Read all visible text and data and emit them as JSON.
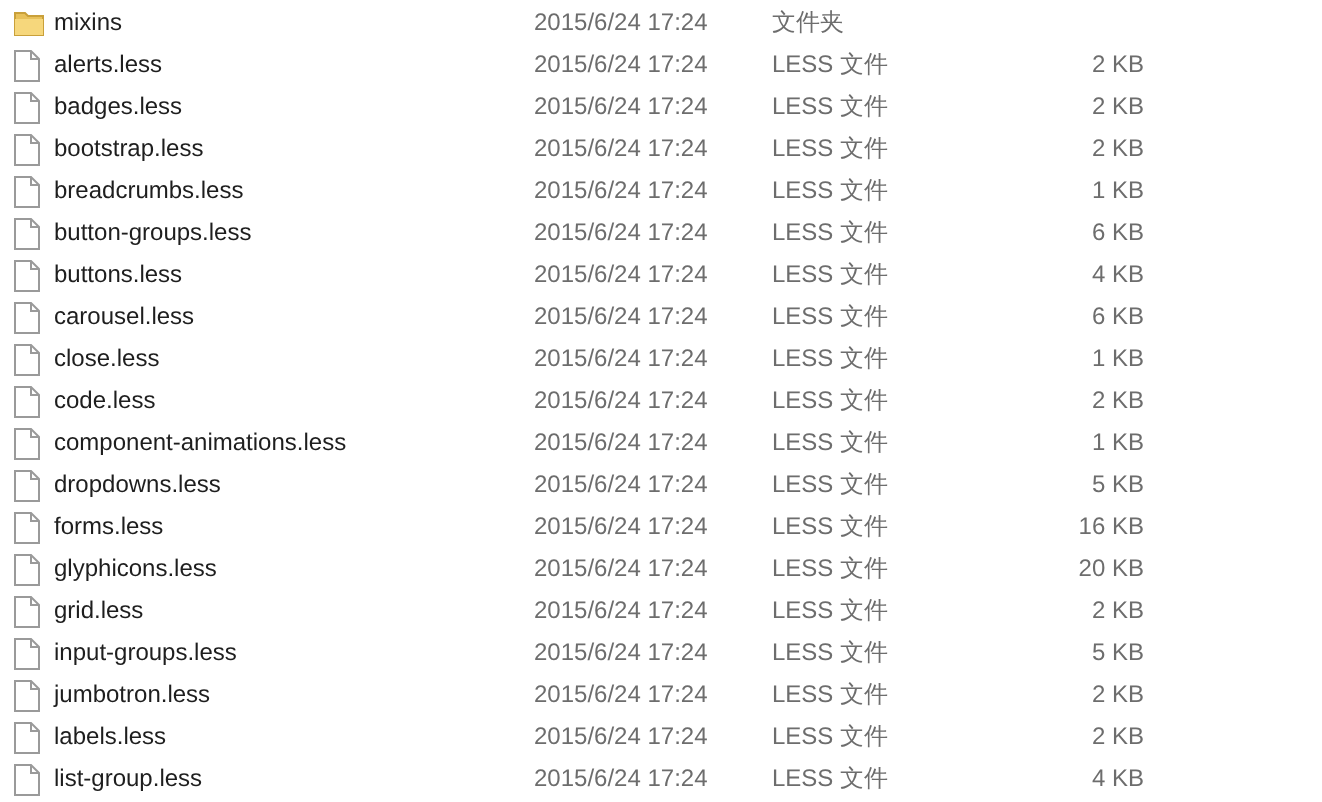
{
  "files": [
    {
      "kind": "folder",
      "name": "mixins",
      "date": "2015/6/24 17:24",
      "type": "文件夹"
    },
    {
      "kind": "file",
      "name": "alerts.less",
      "date": "2015/6/24 17:24",
      "type": "LESS 文件",
      "size": "2 KB"
    },
    {
      "kind": "file",
      "name": "badges.less",
      "date": "2015/6/24 17:24",
      "type": "LESS 文件",
      "size": "2 KB"
    },
    {
      "kind": "file",
      "name": "bootstrap.less",
      "date": "2015/6/24 17:24",
      "type": "LESS 文件",
      "size": "2 KB"
    },
    {
      "kind": "file",
      "name": "breadcrumbs.less",
      "date": "2015/6/24 17:24",
      "type": "LESS 文件",
      "size": "1 KB"
    },
    {
      "kind": "file",
      "name": "button-groups.less",
      "date": "2015/6/24 17:24",
      "type": "LESS 文件",
      "size": "6 KB"
    },
    {
      "kind": "file",
      "name": "buttons.less",
      "date": "2015/6/24 17:24",
      "type": "LESS 文件",
      "size": "4 KB"
    },
    {
      "kind": "file",
      "name": "carousel.less",
      "date": "2015/6/24 17:24",
      "type": "LESS 文件",
      "size": "6 KB"
    },
    {
      "kind": "file",
      "name": "close.less",
      "date": "2015/6/24 17:24",
      "type": "LESS 文件",
      "size": "1 KB"
    },
    {
      "kind": "file",
      "name": "code.less",
      "date": "2015/6/24 17:24",
      "type": "LESS 文件",
      "size": "2 KB"
    },
    {
      "kind": "file",
      "name": "component-animations.less",
      "date": "2015/6/24 17:24",
      "type": "LESS 文件",
      "size": "1 KB"
    },
    {
      "kind": "file",
      "name": "dropdowns.less",
      "date": "2015/6/24 17:24",
      "type": "LESS 文件",
      "size": "5 KB"
    },
    {
      "kind": "file",
      "name": "forms.less",
      "date": "2015/6/24 17:24",
      "type": "LESS 文件",
      "size": "16 KB"
    },
    {
      "kind": "file",
      "name": "glyphicons.less",
      "date": "2015/6/24 17:24",
      "type": "LESS 文件",
      "size": "20 KB"
    },
    {
      "kind": "file",
      "name": "grid.less",
      "date": "2015/6/24 17:24",
      "type": "LESS 文件",
      "size": "2 KB"
    },
    {
      "kind": "file",
      "name": "input-groups.less",
      "date": "2015/6/24 17:24",
      "type": "LESS 文件",
      "size": "5 KB"
    },
    {
      "kind": "file",
      "name": "jumbotron.less",
      "date": "2015/6/24 17:24",
      "type": "LESS 文件",
      "size": "2 KB"
    },
    {
      "kind": "file",
      "name": "labels.less",
      "date": "2015/6/24 17:24",
      "type": "LESS 文件",
      "size": "2 KB"
    },
    {
      "kind": "file",
      "name": "list-group.less",
      "date": "2015/6/24 17:24",
      "type": "LESS 文件",
      "size": "4 KB"
    }
  ]
}
